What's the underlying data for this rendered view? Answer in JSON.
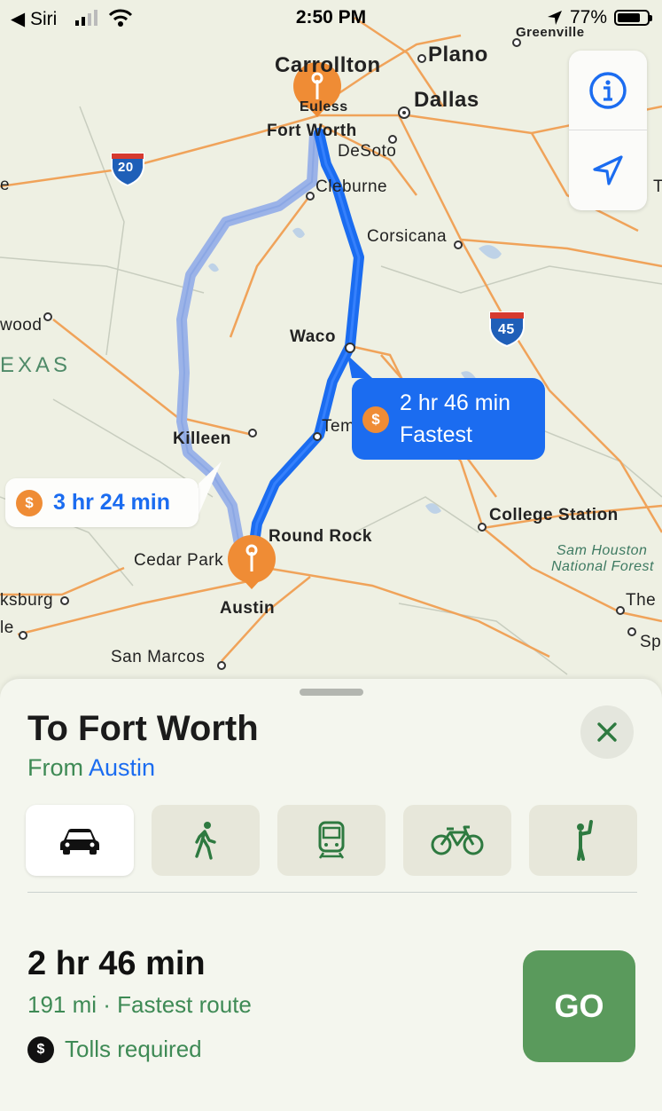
{
  "status_bar": {
    "back_label": "◀ Siri",
    "time": "2:50 PM",
    "battery": "77%",
    "battery_level": 0.77
  },
  "map": {
    "cities": {
      "carrollton": "Carrollton",
      "plano": "Plano",
      "dallas": "Dallas",
      "euless": "Euless",
      "fort_worth": "Fort Worth",
      "desoto": "DeSoto",
      "cleburne": "Cleburne",
      "corsicana": "Corsicana",
      "waco": "Waco",
      "temple": "Tem",
      "killeen": "Killeen",
      "round_rock": "Round Rock",
      "cedar_park": "Cedar Park",
      "austin": "Austin",
      "san_marcos": "San Marcos",
      "college_station": "College Station",
      "sam_houston": "Sam Houston",
      "national_forest": "National Forest",
      "greenville": "Greenville",
      "wood": "wood",
      "ksburg": "ksburg",
      "le": "le",
      "the": "The",
      "sp": "Sp",
      "e": "e",
      "t": "T",
      "texas": "EXAS"
    },
    "highways": {
      "i20": "20",
      "i45": "45"
    },
    "route_fastest": {
      "duration": "2 hr 46 min",
      "label": "Fastest",
      "color": "#1b6cf0"
    },
    "route_alt": {
      "duration": "3 hr 24 min",
      "color": "#8fa9e6"
    },
    "toll_symbol": "$"
  },
  "controls": {
    "info_icon": "info-icon",
    "locate_icon": "location-arrow-icon"
  },
  "sheet": {
    "destination": "To Fort Worth",
    "from_prefix": "From",
    "origin": "Austin",
    "modes": [
      "Drive",
      "Walk",
      "Transit",
      "Cycle",
      "Ride Share"
    ],
    "selected_mode": "Drive",
    "eta": "2 hr 46 min",
    "distance": "191 mi · Fastest route",
    "tolls_symbol": "$",
    "tolls": "Tolls required",
    "go_label": "GO",
    "accent": "#5a9a5c"
  }
}
